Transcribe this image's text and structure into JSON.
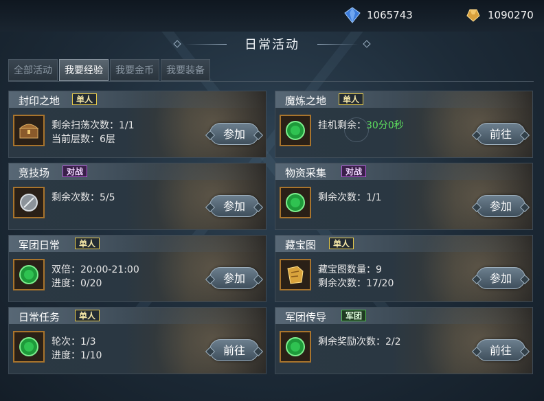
{
  "currency": [
    {
      "icon": "blue-diamond-icon",
      "amount": "1065743",
      "color": "#3c7bd9"
    },
    {
      "icon": "gold-ingot-icon",
      "amount": "1090270",
      "color": "#d9a03c"
    }
  ],
  "title": "日常活动",
  "tabs": [
    {
      "label": "全部活动",
      "active": false
    },
    {
      "label": "我要经验",
      "active": true
    },
    {
      "label": "我要金币",
      "active": false
    },
    {
      "label": "我要装备",
      "active": false
    }
  ],
  "cards": [
    {
      "title": "封印之地",
      "badge": "单人",
      "badge_type": "solo",
      "icon": "treasure-chest-icon",
      "lines": [
        "剩余扫荡次数：1/1",
        "当前层数：6层"
      ],
      "button": "参加"
    },
    {
      "title": "魔炼之地",
      "badge": "单人",
      "badge_type": "solo",
      "icon": "green-token-icon",
      "label": "挂机剩余：",
      "value": "30分0秒",
      "button": "前往"
    },
    {
      "title": "竞技场",
      "badge": "对战",
      "badge_type": "pvp",
      "icon": "silver-shield-icon",
      "lines": [
        "剩余次数：5/5"
      ],
      "button": "参加"
    },
    {
      "title": "物资采集",
      "badge": "对战",
      "badge_type": "pvp",
      "icon": "green-token-icon",
      "lines": [
        "剩余次数：1/1"
      ],
      "button": "参加"
    },
    {
      "title": "军团日常",
      "badge": "单人",
      "badge_type": "solo",
      "icon": "green-token-icon",
      "lines": [
        "双倍：20:00-21:00",
        "进度：0/20"
      ],
      "button": "参加"
    },
    {
      "title": "藏宝图",
      "badge": "单人",
      "badge_type": "solo",
      "icon": "treasure-map-icon",
      "lines": [
        "藏宝图数量：9",
        "剩余次数：17/20"
      ],
      "button": "参加"
    },
    {
      "title": "日常任务",
      "badge": "单人",
      "badge_type": "solo",
      "icon": "green-token-icon",
      "lines": [
        "轮次：1/3",
        "进度：1/10"
      ],
      "button": "前往"
    },
    {
      "title": "军团传导",
      "badge": "军团",
      "badge_type": "legion",
      "icon": "green-token-icon",
      "lines": [
        "剩余奖励次数：2/2"
      ],
      "button": "前往"
    }
  ],
  "colors": {
    "accent_gold": "#e6c94a",
    "pvp_purple": "#b25ad6",
    "legion_green": "#4fb74f",
    "timer_green": "#5ee05e"
  }
}
